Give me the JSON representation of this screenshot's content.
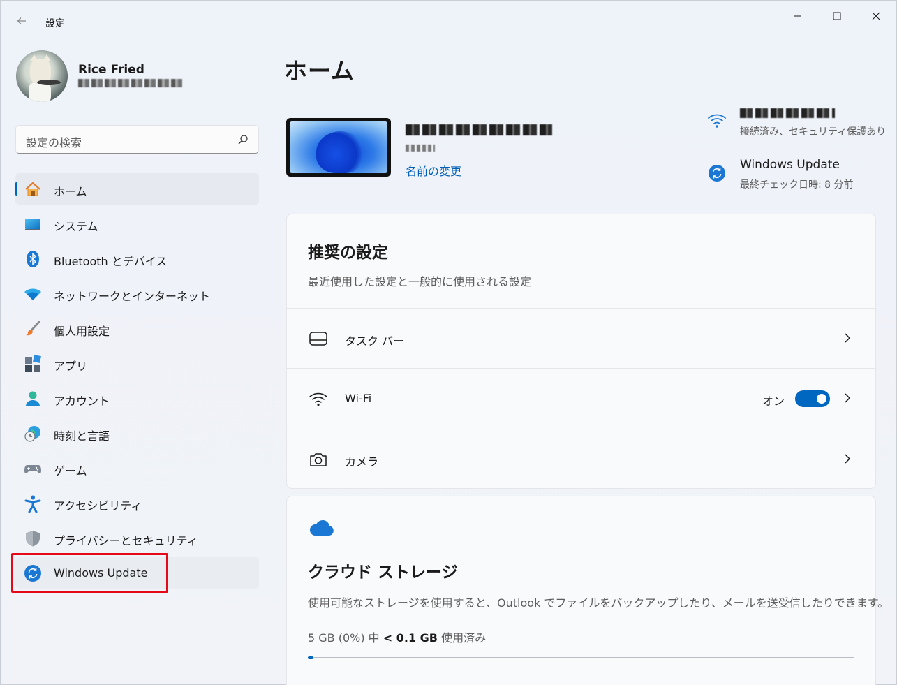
{
  "window": {
    "app_title": "設定",
    "back_icon": "arrow-left-icon",
    "controls": [
      "minimize-icon",
      "maximize-icon",
      "close-icon"
    ]
  },
  "profile": {
    "name": "Rice Fried"
  },
  "search": {
    "placeholder": "設定の検索"
  },
  "sidebar": {
    "items": [
      {
        "label": "ホーム",
        "icon": "home-icon",
        "active": true
      },
      {
        "label": "システム",
        "icon": "system-icon"
      },
      {
        "label": "Bluetooth とデバイス",
        "icon": "bluetooth-icon"
      },
      {
        "label": "ネットワークとインターネット",
        "icon": "network-icon"
      },
      {
        "label": "個人用設定",
        "icon": "brush-icon"
      },
      {
        "label": "アプリ",
        "icon": "apps-icon"
      },
      {
        "label": "アカウント",
        "icon": "account-icon"
      },
      {
        "label": "時刻と言語",
        "icon": "time-language-icon"
      },
      {
        "label": "ゲーム",
        "icon": "gamepad-icon"
      },
      {
        "label": "アクセシビリティ",
        "icon": "accessibility-icon"
      },
      {
        "label": "プライバシーとセキュリティ",
        "icon": "shield-icon"
      },
      {
        "label": "Windows Update",
        "icon": "windows-update-icon",
        "highlighted": true
      }
    ]
  },
  "main": {
    "page_title": "ホーム",
    "device": {
      "rename_link": "名前の変更"
    },
    "status": {
      "wifi_subtitle": "接続済み、セキュリティ保護あり",
      "update_title": "Windows Update",
      "update_subtitle": "最終チェック日時: 8 分前"
    },
    "recommended": {
      "title": "推奨の設定",
      "subtitle": "最近使用した設定と一般的に使用される設定",
      "rows": [
        {
          "label": "タスク バー",
          "icon": "taskbar-icon"
        },
        {
          "label": "Wi-Fi",
          "icon": "wifi-icon",
          "toggle_label": "オン",
          "toggle_on": true
        },
        {
          "label": "カメラ",
          "icon": "camera-icon"
        }
      ]
    },
    "cloud": {
      "icon": "cloud-icon",
      "title": "クラウド ストレージ",
      "description": "使用可能なストレージを使用すると、Outlook でファイルをバックアップしたり、メールを送受信したりできます。",
      "usage_total": "5 GB (0%) 中",
      "usage_used": "< 0.1 GB",
      "usage_suffix": "使用済み",
      "usage_fraction": 0.01
    }
  },
  "colors": {
    "accent": "#0067c0",
    "highlight_border": "#e5091a",
    "link": "#005fb8"
  }
}
